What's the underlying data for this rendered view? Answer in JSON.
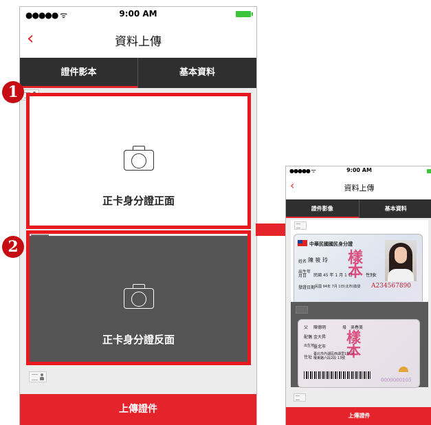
{
  "colors": {
    "accent": "#e5232b",
    "tab_bg": "#2f2f2f",
    "callout": "#e8181f"
  },
  "left_phone": {
    "status": {
      "carrier": "●●●●● ᯤ",
      "time": "9:00 AM"
    },
    "nav": {
      "back_icon": "‹",
      "title": "資料上傳"
    },
    "tabs": [
      {
        "label": "證件影本",
        "active": true
      },
      {
        "label": "基本資料",
        "active": false
      }
    ],
    "front_card": {
      "label": "正卡身分證正面"
    },
    "back_card": {
      "label": "正卡身分證反面"
    },
    "badges": [
      "1",
      "2"
    ],
    "upload_button": "上傳證件"
  },
  "right_phone": {
    "status": {
      "carrier": "●●●●● ᯤ",
      "time": "9:00 AM"
    },
    "nav": {
      "back_icon": "‹",
      "title": "資料上傳"
    },
    "tabs": [
      {
        "label": "證件影像",
        "active": true
      },
      {
        "label": "基本資料",
        "active": false
      }
    ],
    "id_front": {
      "header": "中華民國國民身分證",
      "name_label": "姓名",
      "name": "陳 筱 玲",
      "birth_label": "出生年月日",
      "birth": "民國 45 年 1 月 1 日",
      "gender_label": "性別",
      "gender": "女",
      "issue_label": "發證日期",
      "issue": "民國 94年 7月 1日(北市)換發",
      "id_number": "A234567890",
      "stamp": "樣本"
    },
    "id_back": {
      "father_label": "父",
      "father": "陳德明",
      "mother_label": "母",
      "mother": "吳春美",
      "spouse_label": "配偶",
      "spouse": "金大昇",
      "birthplace_label": "出生地",
      "birthplace": "臺北市",
      "address_label": "住址",
      "address": "臺北市內湖區西湖里1鄰 民權東路六段2段 13號",
      "serial": "0000000105",
      "stamp": "樣本"
    },
    "upload_button": "上傳證件"
  }
}
